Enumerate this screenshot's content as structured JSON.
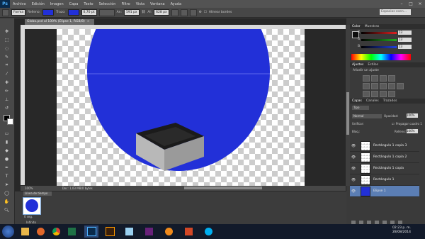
{
  "app": {
    "logo": "Ps"
  },
  "menu": [
    "Archivo",
    "Edición",
    "Imagen",
    "Capa",
    "Texto",
    "Selección",
    "Filtro",
    "Vista",
    "Ventana",
    "Ayuda"
  ],
  "window_controls": [
    "–",
    "□",
    "×"
  ],
  "options": {
    "mode": "Forma",
    "fill_label": "Relleno:",
    "stroke_label": "Trazo:",
    "stroke_width": "0,70 pt",
    "w_label": "An:",
    "w_value": "591 px",
    "h_label": "Al:",
    "h_value": "628 px",
    "align_edges": "Alinear bordes",
    "workspace_search": "Espacios esen..."
  },
  "document": {
    "tab_title": "Globo.psd al 100% (Elipse 1, RGB/8)",
    "tab_close": "×",
    "status_zoom": "100%",
    "status_doc": "Doc: 1,03 MB/0 bytes"
  },
  "timeline": {
    "tab": "Línea de tiempo",
    "frame_delay": "0 seg.",
    "loop": "Infinito"
  },
  "color_panel": {
    "tabs": [
      "Color",
      "Muestras"
    ],
    "channels": [
      {
        "label": "R",
        "value": "13",
        "color": "#e02020"
      },
      {
        "label": "G",
        "value": "13",
        "color": "#20b020"
      },
      {
        "label": "B",
        "value": "13",
        "color": "#2040e0"
      }
    ]
  },
  "adjust_panel": {
    "tabs": [
      "Ajustes",
      "Estilos"
    ],
    "title": "Añadir un ajuste"
  },
  "layers_panel": {
    "tabs": [
      "Capas",
      "Canales",
      "Trazados"
    ],
    "kind": "Tipo",
    "blend": "Normal",
    "opacity_label": "Opacidad:",
    "opacity": "100%",
    "unify_label": "Unificar:",
    "propagate": "Propagar cuadro 1",
    "lock_label": "Bloq.:",
    "fill_label": "Relleno:",
    "fill": "100%",
    "layers": [
      {
        "name": "Rectángulo 1 copia 3",
        "selected": false
      },
      {
        "name": "Rectángulo 1 copia 2",
        "selected": false
      },
      {
        "name": "Rectángulo 1 copia",
        "selected": false
      },
      {
        "name": "Rectángulo 1",
        "selected": false
      },
      {
        "name": "Elipse 1",
        "selected": true
      }
    ]
  },
  "canvas": {
    "ellipse_color": "#2230d8",
    "box_top_color": "#1b1b1b",
    "box_front_color": "#b8b8b8"
  },
  "taskbar": {
    "clock_time": "02:23 p. m.",
    "clock_date": "28/08/2014"
  }
}
